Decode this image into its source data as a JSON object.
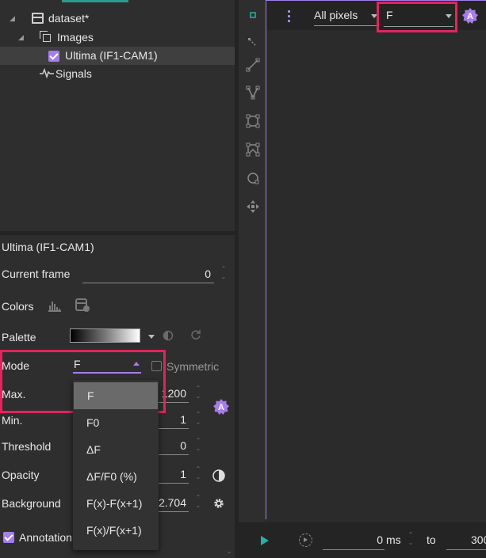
{
  "tree": {
    "dataset_label": "dataset*",
    "images_label": "Images",
    "image_item_label": "Ultima (IF1-CAM1)",
    "signals_label": "Signals"
  },
  "props": {
    "section_title": "Ultima (IF1-CAM1)",
    "current_frame_label": "Current frame",
    "current_frame_value": "0",
    "colors_label": "Colors",
    "palette_label": "Palette",
    "mode_label": "Mode",
    "mode_value": "F",
    "symmetric_label": "Symmetric",
    "max_label": "Max.",
    "max_value": "1200",
    "min_label": "Min.",
    "min_value": "1",
    "threshold_label": "Threshold",
    "threshold_value": "0",
    "opacity_label": "Opacity",
    "opacity_value": "1",
    "background_label": "Background",
    "background_value": "2.704",
    "annotations_label": "Annotation"
  },
  "mode_menu": {
    "options": [
      "F",
      "F0",
      "ΔF",
      "ΔF/F0 (%)",
      "F(x)-F(x+1)",
      "F(x)/F(x+1)"
    ],
    "selected": "F"
  },
  "viewer": {
    "pixels_value": "All pixels",
    "channel_value": "F"
  },
  "playback": {
    "start_value": "0",
    "unit": "ms",
    "to_label": "to",
    "end_value": "300"
  },
  "colors": {
    "accent": "#a57ee8",
    "highlight": "#e3245c",
    "teal": "#2ab0a0"
  }
}
